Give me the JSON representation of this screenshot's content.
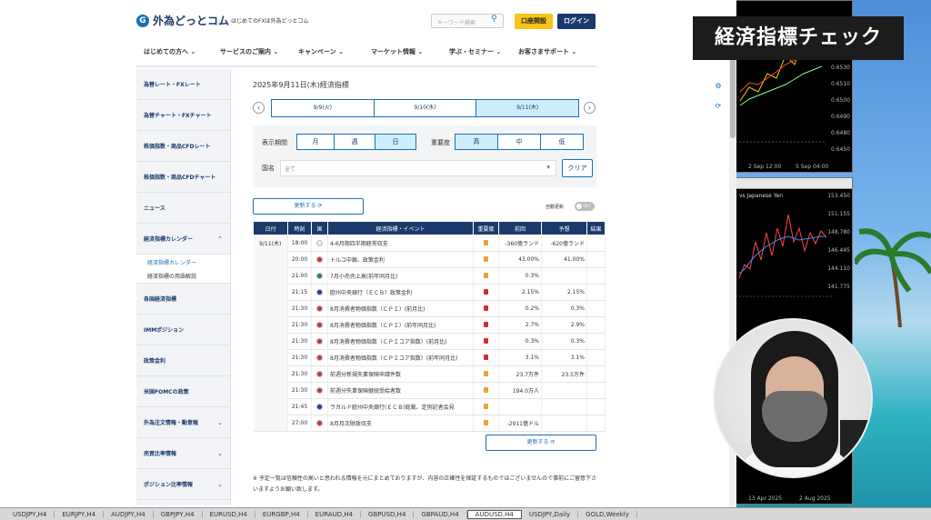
{
  "overlay_title": "経済指標チェック",
  "header": {
    "logo_mark": "G",
    "logo_text": "外為どっとコム",
    "tagline": "はじめてのFXは外為どっとコム",
    "search_placeholder": "キーワード検索",
    "open_account": "口座開設",
    "login": "ログイン"
  },
  "nav": [
    "はじめての方へ ⌄",
    "サービスのご案内 ⌄",
    "キャンペーン ⌄",
    "マーケット情報 ⌄",
    "学ぶ・セミナー ⌄",
    "お客さまサポート ⌄"
  ],
  "sidebar": {
    "items_top": [
      "為替レート・FXレート",
      "為替チャート・FXチャート",
      "株価指数・商品CFDレート",
      "株価指数・商品CFDチャート",
      "ニュース",
      "経済指標カレンダー"
    ],
    "subs": [
      "経済指標カレンダー",
      "経済指標の用語解説"
    ],
    "items_bottom": [
      "各国経済指標",
      "IMMポジション",
      "政策金利",
      "米国FOMCの政策",
      "外為注文情報・動意報",
      "売買比率情報",
      "ポジション比率情報"
    ]
  },
  "main": {
    "title": "2025年9月11日(木)経済指標",
    "prev": "‹",
    "next": "›",
    "date_tabs": [
      "9/9(火)",
      "9/10(水)",
      "9/11(木)"
    ],
    "period_label": "表示期間",
    "period": [
      "月",
      "週",
      "日"
    ],
    "importance_label": "重要度",
    "importance": [
      "高",
      "中",
      "低"
    ],
    "country_label": "国名",
    "country_value": "全て",
    "clear": "クリア",
    "refresh": "更新する ⟳",
    "auto_update": "自動更新",
    "toggle": "OFF",
    "columns": [
      "日付",
      "時刻",
      "国",
      "経済指標・イベント",
      "重要度",
      "前回",
      "予想",
      "結果"
    ],
    "date_cell": "9/11(木)",
    "rows": [
      {
        "time": "18:00",
        "flag": "#eeeeee",
        "event": "4-6月期四半期経常収支",
        "imp": "#e8a23a",
        "prev": "-360億ランド",
        "fc": "-620億ランド"
      },
      {
        "time": "20:00",
        "flag": "#d62b2b",
        "event": "トルコ中銀、政策金利",
        "imp": "#e8a23a",
        "prev": "43.00%",
        "fc": "41.00%"
      },
      {
        "time": "21:00",
        "flag": "#2d8a3e",
        "event": "7月小売売上高(前年同月比)",
        "imp": "#e8a23a",
        "prev": "0.3%",
        "fc": ""
      },
      {
        "time": "21:15",
        "flag": "#1b3fa8",
        "event": "欧州中央銀行（ＥＣＢ）政策金利",
        "imp": "#d62b2b",
        "prev": "2.15%",
        "fc": "2.15%"
      },
      {
        "time": "21:30",
        "flag": "#c33",
        "event": "8月消費者物価指数（ＣＰＩ）(前月比)",
        "imp": "#d62b2b",
        "prev": "0.2%",
        "fc": "0.3%"
      },
      {
        "time": "21:30",
        "flag": "#c33",
        "event": "8月消費者物価指数（ＣＰＩ）(前年同月比)",
        "imp": "#d62b2b",
        "prev": "2.7%",
        "fc": "2.9%"
      },
      {
        "time": "21:30",
        "flag": "#c33",
        "event": "8月消費者物価指数（ＣＰＩコア指数）(前月比)",
        "imp": "#d62b2b",
        "prev": "0.3%",
        "fc": "0.3%"
      },
      {
        "time": "21:30",
        "flag": "#c33",
        "event": "8月消費者物価指数（ＣＰＩコア指数）(前年同月比)",
        "imp": "#d62b2b",
        "prev": "3.1%",
        "fc": "3.1%"
      },
      {
        "time": "21:30",
        "flag": "#c33",
        "event": "前週分新規失業保険申請件数",
        "imp": "#e8a23a",
        "prev": "23.7万件",
        "fc": "23.5万件"
      },
      {
        "time": "21:30",
        "flag": "#c33",
        "event": "前週分失業保険継続受給者数",
        "imp": "#e8a23a",
        "prev": "194.0万人",
        "fc": ""
      },
      {
        "time": "21:45",
        "flag": "#1b3fa8",
        "event": "ラガルド欧州中央銀行(ＥＣＢ)総裁、定例記者会見",
        "imp": "#e8a23a",
        "prev": "",
        "fc": ""
      },
      {
        "time": "27:00",
        "flag": "#c33",
        "event": "8月月次財政収支",
        "imp": "#e8a23a",
        "prev": "-2911億ドル",
        "fc": ""
      }
    ],
    "note": "※ 予定一覧は信頼性の高いと思われる情報を元にまとめておりますが、内容の正確性を保証するものではございませんので事前にご留意下さいますようお願い致します。"
  },
  "mt4": {
    "top_prices": [
      "0.6530",
      "0.6510",
      "0.6500",
      "0.6490",
      "0.6480",
      "0.6450"
    ],
    "top_dates": [
      "2 Sep 12:00",
      "5 Sep 04:00"
    ],
    "bottom_title": "vs Japanese Yen",
    "bottom_prices": [
      "153.450",
      "151.155",
      "148.780",
      "146.445",
      "144.110",
      "141.775"
    ],
    "bottom_dates": [
      "13 Apr 2025",
      "2 Aug 2025"
    ]
  },
  "taskbar_tabs": [
    "USDJPY,H4",
    "EURJPY,H4",
    "AUDJPY,H4",
    "GBPJPY,H4",
    "EURUSD,H4",
    "EURGBP,H4",
    "EURAUD,H4",
    "GBPUSD,H4",
    "GBPAUD,H4",
    "AUDUSD,H4",
    "USDJPY,Daily",
    "GOLD,Weekly"
  ],
  "colors": {
    "brand": "#1b3a6b",
    "accent": "#1b6fb8",
    "yellow": "#f5c518",
    "selected": "#cdeefa"
  }
}
